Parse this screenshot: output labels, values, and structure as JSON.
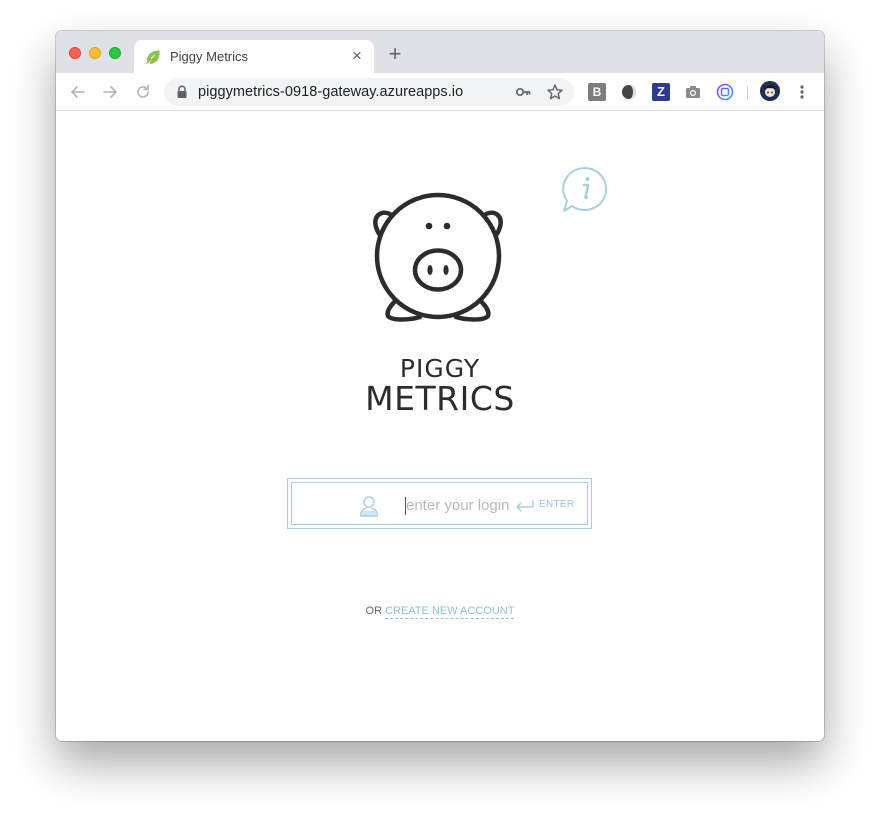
{
  "browser": {
    "tab": {
      "title": "Piggy Metrics",
      "favicon": "spring-leaf-icon",
      "close_glyph": "×"
    },
    "new_tab_glyph": "+",
    "toolbar": {
      "back_icon": "arrow-left-icon",
      "forward_icon": "arrow-right-icon",
      "reload_icon": "reload-icon",
      "url": "piggymetrics-0918-gateway.azureapps.io",
      "key_icon": "key-icon",
      "star_icon": "star-icon",
      "extensions": [
        {
          "name": "b-extension",
          "glyph": "B"
        },
        {
          "name": "circle-extension",
          "glyph": ""
        },
        {
          "name": "z-extension",
          "glyph": "Z"
        },
        {
          "name": "camera-extension",
          "glyph": ""
        },
        {
          "name": "target-extension",
          "glyph": ""
        }
      ],
      "menu_icon": "more-vertical-icon"
    }
  },
  "page": {
    "logo": {
      "line1": "PIGGY",
      "line2": "METRICS"
    },
    "login": {
      "placeholder": "enter your login",
      "value": "",
      "enter_label": "ENTER"
    },
    "signup": {
      "prefix": "OR",
      "link": "CREATE NEW ACCOUNT"
    }
  },
  "colors": {
    "accent": "#a9cfdf",
    "link": "#8fbfd2",
    "logo": "#2c2c2c",
    "tabstrip": "#dee1e6"
  }
}
